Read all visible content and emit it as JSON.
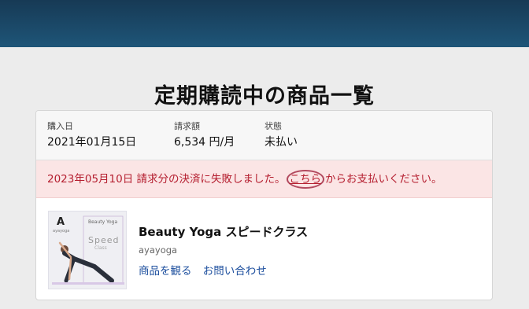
{
  "page": {
    "title": "定期購読中の商品一覧"
  },
  "subscription": {
    "purchase_date_label": "購入日",
    "purchase_date": "2021年01月15日",
    "billing_label": "請求額",
    "billing_amount": "6,534 円/月",
    "status_label": "状態",
    "status_value": "未払い"
  },
  "alert": {
    "text_before": "2023年05月10日 請求分の決済に失敗しました。",
    "link_text": "こちら",
    "text_after": "からお支払いください。"
  },
  "product": {
    "name": "Beauty Yoga スピードクラス",
    "seller": "ayayoga",
    "watch_link": "商品を観る",
    "contact_link": "お問い合わせ",
    "thumbnail": {
      "logo": "A",
      "brand_tag": "ayayoga",
      "category": "Beauty Yoga",
      "title": "Speed",
      "subtitle": "Class"
    }
  },
  "colors": {
    "topbar": "#1e5578",
    "alert_text": "#b51f30",
    "alert_bg": "#fbe5e5",
    "link": "#1d4f9e"
  }
}
